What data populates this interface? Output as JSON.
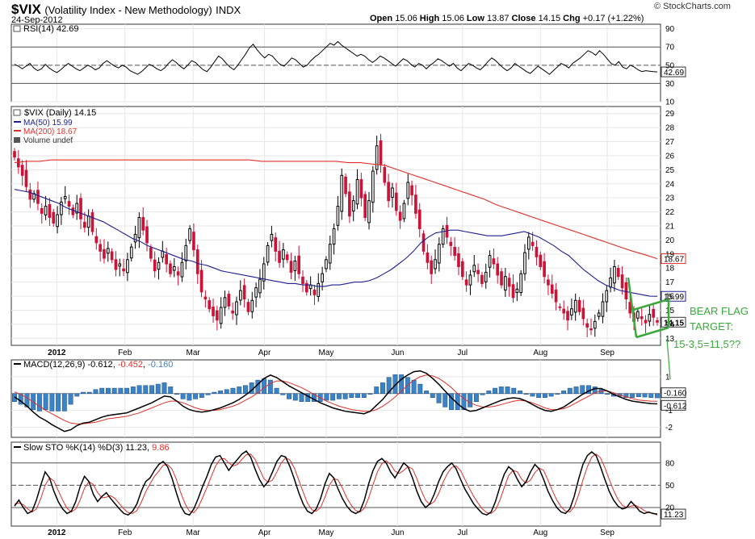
{
  "header": {
    "symbol": "$VIX",
    "name": "(Volatility Index - New Methodology)",
    "exchange": "INDX",
    "date": "24-Sep-2012",
    "open_label": "Open",
    "open": "15.06",
    "high_label": "High",
    "high": "15.06",
    "low_label": "Low",
    "low": "13.87",
    "close_label": "Close",
    "close": "14.15",
    "chg_label": "Chg",
    "chg": "+0.17 (+1.22%)",
    "brand": "© StockCharts.com"
  },
  "annotation": {
    "line1": "BEAR FLAG",
    "line2": "TARGET:",
    "line3": "15-3,5=11,5??"
  },
  "colors": {
    "up": "#000000",
    "down": "#cc1236",
    "ma50": "#1f1f8f",
    "ma200": "#e0302a",
    "macd_hist": "#3b83c7",
    "macd_signal": "#e0302a",
    "sto_d": "#e0302a",
    "annotation": "#3aa83a",
    "grid": "#e6e6e6"
  },
  "chart_data": [
    {
      "panel": "rsi",
      "type": "line",
      "legend": "RSI(14) 42.69",
      "ylim": [
        10,
        95
      ],
      "yticks": [
        10,
        30,
        50,
        70,
        90
      ],
      "ref_lines": [
        30,
        70
      ],
      "last_value": "42.69",
      "values": [
        51,
        49,
        46,
        49,
        52,
        47,
        44,
        46,
        51,
        47,
        44,
        42,
        45,
        49,
        52,
        49,
        46,
        44,
        47,
        50,
        48,
        45,
        47,
        52,
        55,
        52,
        49,
        47,
        50,
        48,
        44,
        42,
        40,
        43,
        47,
        51,
        49,
        46,
        44,
        47,
        52,
        56,
        53,
        49,
        46,
        50,
        55,
        53,
        49,
        45,
        43,
        48,
        54,
        60,
        57,
        52,
        48,
        45,
        50,
        56,
        62,
        69,
        73,
        67,
        62,
        58,
        62,
        60,
        55,
        51,
        49,
        53,
        58,
        56,
        52,
        48,
        50,
        55,
        59,
        62,
        66,
        70,
        74,
        72,
        76,
        72,
        69,
        66,
        63,
        60,
        62,
        60,
        56,
        53,
        56,
        60,
        58,
        55,
        52,
        49,
        53,
        57,
        55,
        51,
        48,
        52,
        50,
        46,
        50,
        53,
        57,
        55,
        52,
        49,
        52,
        47,
        44,
        48,
        52,
        50,
        47,
        45,
        49,
        54,
        58,
        55,
        51,
        47,
        44,
        47,
        52,
        49,
        46,
        43,
        41,
        45,
        49,
        46,
        43,
        40,
        44,
        48,
        52,
        50,
        47,
        52,
        55,
        58,
        62,
        66,
        64,
        61,
        66,
        62,
        57,
        52,
        50,
        54,
        48,
        46,
        50,
        48,
        45,
        43,
        44,
        43.5,
        43,
        42.69
      ]
    },
    {
      "panel": "price",
      "type": "candlestick",
      "legend_symbol": "$VIX (Daily) 14.15",
      "legend_ma50": "MA(50) 15.99",
      "legend_ma200": "MA(200) 18.67",
      "legend_volume": "Volume undef",
      "ylim": [
        12.5,
        29.5
      ],
      "yticks": [
        13,
        14,
        15,
        16,
        17,
        18,
        19,
        20,
        21,
        22,
        23,
        24,
        25,
        26,
        27,
        28,
        29
      ],
      "last_price_label": "14.15",
      "ma50_label": "15.99",
      "ma200_label": "18.67",
      "x_labels": [
        "2012",
        "Feb",
        "Mar",
        "Apr",
        "May",
        "Jun",
        "Jul",
        "Aug",
        "Sep"
      ],
      "close": [
        25.9,
        25.2,
        24.6,
        23.8,
        22.9,
        23.3,
        22.6,
        21.9,
        22.4,
        21.6,
        21.2,
        21.8,
        22.7,
        23.1,
        22.4,
        21.8,
        22.6,
        21.5,
        20.9,
        21.7,
        20.6,
        19.8,
        19.2,
        18.7,
        19.4,
        18.6,
        17.9,
        18.3,
        17.8,
        18.6,
        19.5,
        20.4,
        21.6,
        20.7,
        19.8,
        18.7,
        17.8,
        18.4,
        19.2,
        18.3,
        17.6,
        18.1,
        17.5,
        18.4,
        19.6,
        20.8,
        19.3,
        17.6,
        16.3,
        15.8,
        15.1,
        14.6,
        14.3,
        15.2,
        15.9,
        15.3,
        14.8,
        15.6,
        16.4,
        15.8,
        14.9,
        15.7,
        16.6,
        17.2,
        18.3,
        19.6,
        20.4,
        19.2,
        18.4,
        19.3,
        18.6,
        17.7,
        18.5,
        17.6,
        16.9,
        16.3,
        16.8,
        16.1,
        16.9,
        17.6,
        18.6,
        19.7,
        20.8,
        22.4,
        24.6,
        23.3,
        21.7,
        22.8,
        24.3,
        23.0,
        21.6,
        22.8,
        24.9,
        26.7,
        25.4,
        24.1,
        22.8,
        23.7,
        22.1,
        21.4,
        22.6,
        24.1,
        23.2,
        21.9,
        20.8,
        19.2,
        18.4,
        17.6,
        18.6,
        19.7,
        20.8,
        20.2,
        19.6,
        18.9,
        18.1,
        17.4,
        16.8,
        17.5,
        18.2,
        17.6,
        16.9,
        17.7,
        18.9,
        18.3,
        17.5,
        16.8,
        17.4,
        16.7,
        15.9,
        16.5,
        17.6,
        19.1,
        20.2,
        19.6,
        18.8,
        18.1,
        17.4,
        16.8,
        16.2,
        15.6,
        15.2,
        14.8,
        14.3,
        15.1,
        15.7,
        14.9,
        14.4,
        13.8,
        13.6,
        14.2,
        14.8,
        15.6,
        16.4,
        17.3,
        18.1,
        17.4,
        16.6,
        15.8,
        14.8,
        14.2,
        14.9,
        14.4,
        14.1,
        14.7,
        14.5,
        14.15
      ],
      "ma50": [
        23.6,
        23.5,
        23.4,
        23.2,
        23.0,
        22.8,
        22.6,
        22.3,
        22.1,
        21.9,
        21.7,
        21.5,
        21.3,
        21.0,
        20.7,
        20.4,
        20.1,
        19.9,
        19.6,
        19.4,
        19.2,
        19.0,
        18.8,
        18.6,
        18.5,
        18.3,
        18.2,
        18.0,
        17.8,
        17.7,
        17.6,
        17.5,
        17.4,
        17.3,
        17.2,
        17.1,
        17.0,
        16.9,
        16.9,
        16.8,
        16.8,
        16.7,
        16.7,
        16.8,
        16.8,
        16.9,
        17.0,
        17.0,
        17.1,
        17.3,
        17.6,
        17.9,
        18.3,
        18.7,
        19.2,
        19.8,
        20.2,
        20.5,
        20.6,
        20.7,
        20.7,
        20.6,
        20.5,
        20.4,
        20.3,
        20.3,
        20.3,
        20.4,
        20.5,
        20.6,
        20.4,
        20.2,
        19.9,
        19.6,
        19.2,
        18.9,
        18.4,
        17.9,
        17.5,
        17.1,
        16.8,
        16.6,
        16.4,
        16.3,
        16.2,
        16.1,
        16.0,
        15.99
      ],
      "ma200": [
        25.5,
        25.6,
        25.6,
        25.7,
        25.7,
        25.7,
        25.7,
        25.7,
        25.7,
        25.7,
        25.7,
        25.7,
        25.7,
        25.7,
        25.7,
        25.7,
        25.7,
        25.7,
        25.7,
        25.7,
        25.6,
        25.6,
        25.6,
        25.6,
        25.6,
        25.6,
        25.6,
        25.5,
        25.5,
        25.4,
        25.3,
        25.0,
        24.7,
        24.4,
        24.1,
        23.8,
        23.5,
        23.2,
        22.9,
        22.5,
        22.2,
        21.9,
        21.6,
        21.3,
        21.0,
        20.7,
        20.4,
        20.1,
        19.8,
        19.5,
        19.2,
        18.95,
        18.67
      ]
    },
    {
      "panel": "macd",
      "type": "line",
      "legend_prefix": "MACD(12,26,9)",
      "legend_macd": "-0.612",
      "legend_signal": "-0.452",
      "legend_hist": "-0.160",
      "ylim": [
        -2.6,
        2.0
      ],
      "yticks": [
        -2,
        -1,
        1
      ],
      "last_macd_label": "-0.612",
      "last_signal_label": "-0.160",
      "macd": [
        -0.2,
        -0.45,
        -0.75,
        -1.1,
        -1.4,
        -1.6,
        -1.85,
        -2.05,
        -2.25,
        -2.15,
        -1.9,
        -1.75,
        -1.7,
        -1.55,
        -1.4,
        -1.3,
        -1.25,
        -1.2,
        -1.15,
        -1.0,
        -0.85,
        -0.7,
        -0.55,
        -0.35,
        -0.15,
        -0.2,
        -0.45,
        -0.75,
        -0.95,
        -1.05,
        -1.1,
        -1.05,
        -0.95,
        -0.85,
        -0.7,
        -0.55,
        -0.35,
        -0.1,
        0.2,
        0.55,
        0.9,
        1.1,
        0.95,
        0.7,
        0.45,
        0.25,
        0.05,
        -0.15,
        -0.35,
        -0.55,
        -0.7,
        -0.85,
        -0.95,
        -1.05,
        -1.1,
        -1.15,
        -1.2,
        -1.05,
        -0.7,
        -0.35,
        0.1,
        0.5,
        0.85,
        1.1,
        1.3,
        1.35,
        1.2,
        0.9,
        0.55,
        0.15,
        -0.25,
        -0.6,
        -0.9,
        -1.05,
        -1.0,
        -0.85,
        -0.7,
        -0.55,
        -0.4,
        -0.3,
        -0.25,
        -0.3,
        -0.45,
        -0.65,
        -0.85,
        -1.0,
        -1.05,
        -0.95,
        -0.8,
        -0.55,
        -0.3,
        -0.05,
        0.15,
        0.3,
        0.3,
        0.15,
        -0.05,
        -0.2,
        -0.35,
        -0.45,
        -0.5,
        -0.55,
        -0.6,
        -0.612
      ],
      "signal": [
        0.1,
        -0.05,
        -0.25,
        -0.5,
        -0.75,
        -1.0,
        -1.2,
        -1.4,
        -1.6,
        -1.75,
        -1.8,
        -1.8,
        -1.75,
        -1.7,
        -1.6,
        -1.5,
        -1.45,
        -1.4,
        -1.35,
        -1.25,
        -1.15,
        -1.0,
        -0.85,
        -0.7,
        -0.55,
        -0.45,
        -0.45,
        -0.55,
        -0.7,
        -0.85,
        -0.95,
        -1.0,
        -1.0,
        -0.95,
        -0.85,
        -0.75,
        -0.6,
        -0.4,
        -0.2,
        0.05,
        0.35,
        0.6,
        0.75,
        0.75,
        0.65,
        0.5,
        0.35,
        0.15,
        -0.05,
        -0.25,
        -0.45,
        -0.6,
        -0.75,
        -0.85,
        -0.95,
        -1.0,
        -1.05,
        -1.05,
        -0.95,
        -0.75,
        -0.5,
        -0.2,
        0.15,
        0.5,
        0.8,
        1.0,
        1.1,
        1.05,
        0.9,
        0.65,
        0.35,
        0.0,
        -0.3,
        -0.55,
        -0.7,
        -0.8,
        -0.8,
        -0.75,
        -0.65,
        -0.55,
        -0.45,
        -0.4,
        -0.45,
        -0.55,
        -0.7,
        -0.85,
        -0.95,
        -0.95,
        -0.9,
        -0.75,
        -0.55,
        -0.35,
        -0.15,
        0.05,
        0.15,
        0.15,
        0.05,
        -0.1,
        -0.2,
        -0.3,
        -0.38,
        -0.42,
        -0.45,
        -0.452
      ]
    },
    {
      "panel": "sto",
      "type": "line",
      "legend_prefix": "Slow STO %K(14) %D(3)",
      "legend_k": "11.23",
      "legend_d": "9.86",
      "ylim": [
        -5,
        108
      ],
      "yticks": [
        20,
        50,
        80
      ],
      "ref_lines": [
        20,
        50,
        80
      ],
      "last_value": "11.23",
      "k": [
        22,
        30,
        20,
        12,
        15,
        30,
        50,
        68,
        60,
        42,
        28,
        18,
        12,
        15,
        28,
        48,
        62,
        55,
        38,
        28,
        35,
        40,
        32,
        25,
        18,
        12,
        10,
        15,
        25,
        42,
        55,
        60,
        70,
        78,
        82,
        75,
        60,
        40,
        22,
        12,
        10,
        18,
        32,
        48,
        62,
        78,
        88,
        90,
        80,
        70,
        78,
        85,
        92,
        96,
        88,
        72,
        58,
        48,
        55,
        68,
        82,
        90,
        88,
        75,
        58,
        40,
        25,
        15,
        12,
        18,
        32,
        52,
        66,
        60,
        45,
        32,
        22,
        15,
        12,
        15,
        30,
        52,
        70,
        82,
        86,
        80,
        68,
        60,
        70,
        80,
        75,
        60,
        42,
        28,
        20,
        25,
        38,
        55,
        68,
        75,
        80,
        72,
        58,
        45,
        35,
        25,
        18,
        12,
        10,
        14,
        28,
        48,
        65,
        75,
        70,
        58,
        48,
        55,
        68,
        78,
        72,
        58,
        42,
        30,
        20,
        14,
        12,
        18,
        35,
        58,
        78,
        90,
        95,
        90,
        75,
        58,
        42,
        30,
        22,
        18,
        20,
        28,
        22,
        15,
        12,
        14,
        12,
        11.23
      ],
      "d": [
        25,
        26,
        24,
        18,
        14,
        18,
        32,
        50,
        60,
        56,
        43,
        30,
        19,
        14,
        18,
        30,
        46,
        55,
        51,
        40,
        33,
        34,
        36,
        32,
        25,
        18,
        13,
        12,
        16,
        27,
        41,
        52,
        62,
        69,
        77,
        78,
        72,
        58,
        40,
        25,
        15,
        13,
        20,
        33,
        47,
        62,
        76,
        85,
        86,
        80,
        76,
        78,
        85,
        91,
        92,
        85,
        72,
        59,
        54,
        57,
        68,
        80,
        87,
        84,
        73,
        57,
        41,
        26,
        17,
        15,
        20,
        34,
        50,
        59,
        57,
        46,
        33,
        23,
        16,
        14,
        19,
        33,
        51,
        68,
        79,
        83,
        78,
        69,
        66,
        70,
        75,
        72,
        59,
        43,
        30,
        24,
        28,
        39,
        54,
        66,
        74,
        76,
        70,
        58,
        46,
        35,
        26,
        18,
        13,
        12,
        17,
        30,
        47,
        63,
        70,
        68,
        58,
        53,
        57,
        67,
        73,
        70,
        57,
        43,
        30,
        21,
        15,
        14,
        21,
        37,
        57,
        75,
        88,
        92,
        87,
        74,
        58,
        43,
        31,
        23,
        20,
        22,
        23,
        20,
        16,
        13,
        12.5,
        9.86
      ]
    }
  ]
}
